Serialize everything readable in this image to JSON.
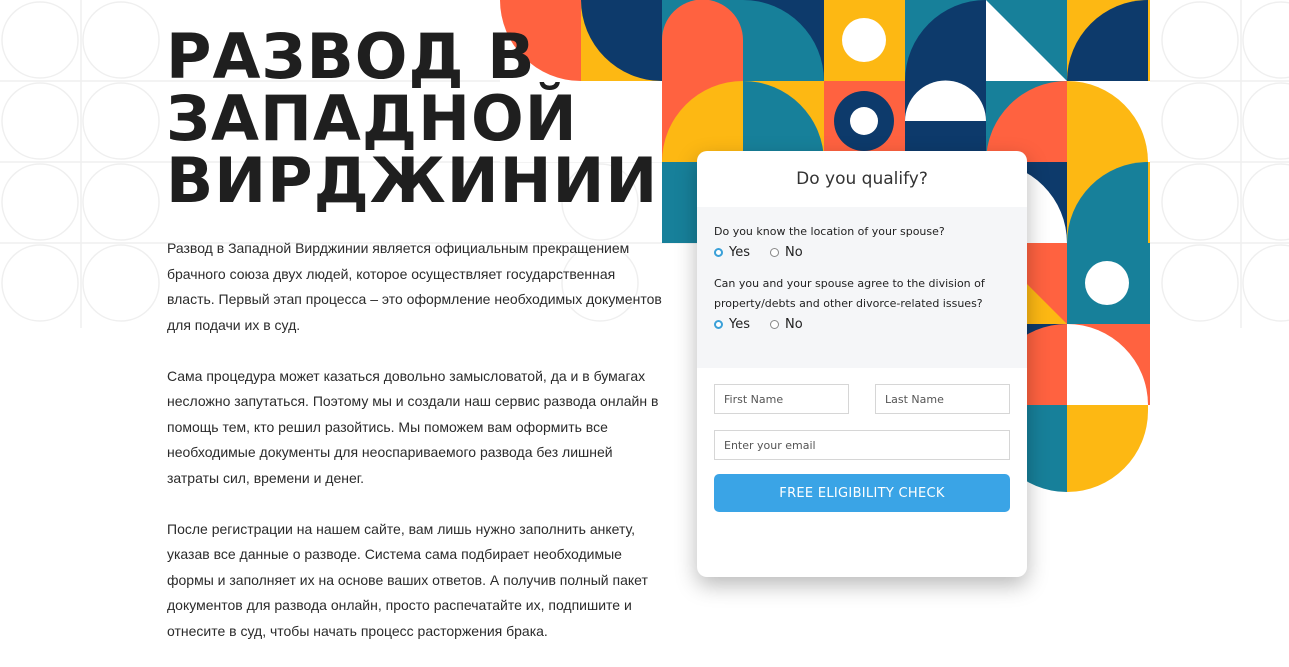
{
  "page": {
    "headline_lines": [
      "РАЗВОД В",
      "ЗАПАДНОЙ",
      "ВИРДЖИНИИ"
    ],
    "paragraphs": [
      "Развод в Западной Вирджинии является официальным прекращением брачного союза двух людей, которое осуществляет государственная власть. Первый этап процесса – это оформление необходимых документов для подачи их в суд.",
      "Сама процедура может казаться довольно замысловатой, да и в бумагах несложно запутаться. Поэтому мы и создали наш сервис развода онлайн в помощь тем, кто решил разойтись. Мы поможем вам оформить все необходимые документы для неоспариваемого развода без лишней затраты сил, времени и денег.",
      "После регистрации на нашем сайте, вам лишь нужно заполнить анкету, указав все данные о разводе. Система сама подбирает необходимые формы и заполняет их на основе ваших ответов. А получив полный пакет документов для развода онлайн, просто распечатайте их, подпишите и отнесите в суд, чтобы начать процесс расторжения брака."
    ]
  },
  "form": {
    "title": "Do you qualify?",
    "q1": {
      "text": "Do you know the location of your spouse?",
      "yes": "Yes",
      "no": "No",
      "selected": "yes"
    },
    "q2": {
      "text": "Can you and your spouse agree to the division of property/debts and other divorce-related issues?",
      "yes": "Yes",
      "no": "No",
      "selected": "yes"
    },
    "first_name_placeholder": "First Name",
    "last_name_placeholder": "Last Name",
    "email_placeholder": "Enter your email",
    "submit_label": "FREE ELIGIBILITY CHECK"
  },
  "colors": {
    "navy": "#0d3a6b",
    "teal": "#17809a",
    "orange": "#ff6240",
    "yellow": "#fdb813",
    "accent_blue": "#3aa4e6"
  }
}
